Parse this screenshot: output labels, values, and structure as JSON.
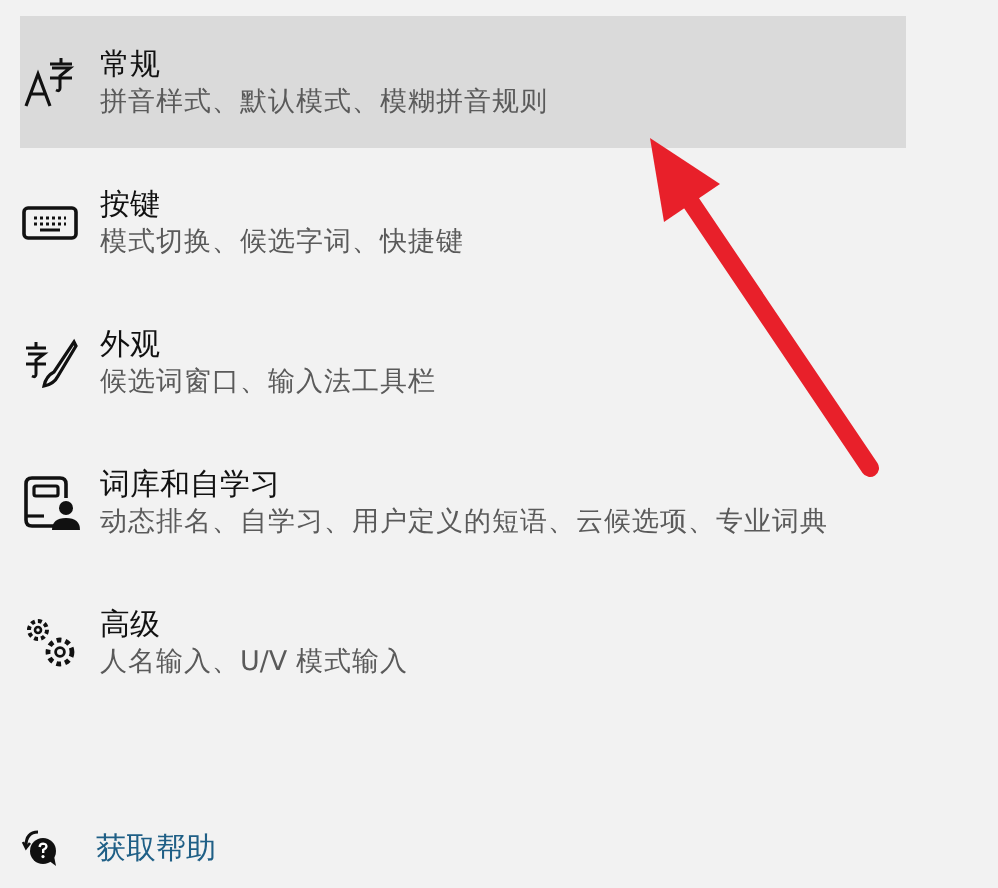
{
  "items": [
    {
      "kind": "general",
      "title": "常规",
      "subtitle": "拼音样式、默认模式、模糊拼音规则",
      "selected": true
    },
    {
      "kind": "keys",
      "title": "按键",
      "subtitle": "模式切换、候选字词、快捷键",
      "selected": false
    },
    {
      "kind": "appearance",
      "title": "外观",
      "subtitle": "候选词窗口、输入法工具栏",
      "selected": false
    },
    {
      "kind": "lexicon",
      "title": "词库和自学习",
      "subtitle": "动态排名、自学习、用户定义的短语、云候选项、专业词典",
      "selected": false
    },
    {
      "kind": "advanced",
      "title": "高级",
      "subtitle": "人名输入、U/V 模式输入",
      "selected": false
    }
  ],
  "help": {
    "label": "获取帮助"
  }
}
